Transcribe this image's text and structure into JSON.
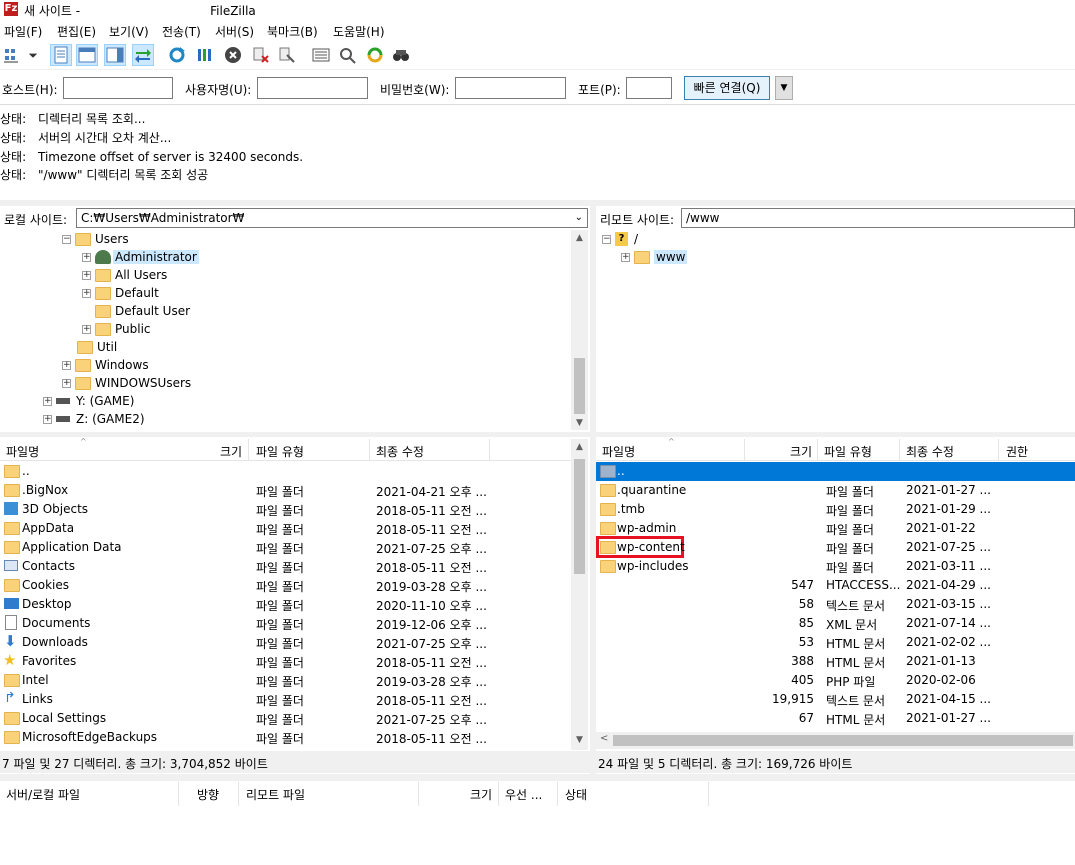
{
  "window": {
    "title_left": "새 사이트 -",
    "title_app": "FileZilla",
    "icon": "filezilla-icon"
  },
  "menu": [
    "파일(F)",
    "편집(E)",
    "보기(V)",
    "전송(T)",
    "서버(S)",
    "북마크(B)",
    "도움말(H)"
  ],
  "quickconnect": {
    "host_label": "호스트(H):",
    "user_label": "사용자명(U):",
    "pass_label": "비밀번호(W):",
    "port_label": "포트(P):",
    "host_value": "",
    "user_value": "",
    "pass_value": "",
    "port_value": "",
    "connect_label": "빠른 연결(Q)"
  },
  "log": [
    {
      "label": "상태:",
      "text": "디렉터리 목록 조회..."
    },
    {
      "label": "상태:",
      "text": "서버의 시간대 오차 계산..."
    },
    {
      "label": "상태:",
      "text": "Timezone offset of server is 32400 seconds."
    },
    {
      "label": "상태:",
      "text": "\"/www\" 디렉터리 목록 조회 성공"
    }
  ],
  "local": {
    "site_label": "로컬 사이트:",
    "path": "C:₩Users₩Administrator₩",
    "tree": [
      {
        "label": "Users",
        "exp": "−"
      },
      {
        "label": "Administrator",
        "exp": "+"
      },
      {
        "label": "All Users",
        "exp": "+"
      },
      {
        "label": "Default",
        "exp": "+"
      },
      {
        "label": "Default User",
        "exp": ""
      },
      {
        "label": "Public",
        "exp": "+"
      },
      {
        "label": "Util",
        "exp": ""
      },
      {
        "label": "Windows",
        "exp": "+"
      },
      {
        "label": "WINDOWSUsers",
        "exp": "+"
      },
      {
        "label": "Y: (GAME)",
        "exp": "+"
      },
      {
        "label": "Z: (GAME2)",
        "exp": "+"
      }
    ],
    "headers": {
      "name": "파일명",
      "size": "크기",
      "type": "파일 유형",
      "modified": "최종 수정"
    },
    "files": [
      {
        "name": "..",
        "type": "",
        "modified": ""
      },
      {
        "name": ".BigNox",
        "type": "파일 폴더",
        "modified": "2021-04-21 오후 ..."
      },
      {
        "name": "3D Objects",
        "type": "파일 폴더",
        "modified": "2018-05-11 오전 ..."
      },
      {
        "name": "AppData",
        "type": "파일 폴더",
        "modified": "2018-05-11 오전 ..."
      },
      {
        "name": "Application Data",
        "type": "파일 폴더",
        "modified": "2021-07-25 오후 ..."
      },
      {
        "name": "Contacts",
        "type": "파일 폴더",
        "modified": "2018-05-11 오전 ..."
      },
      {
        "name": "Cookies",
        "type": "파일 폴더",
        "modified": "2019-03-28 오후 ..."
      },
      {
        "name": "Desktop",
        "type": "파일 폴더",
        "modified": "2020-11-10 오후 ..."
      },
      {
        "name": "Documents",
        "type": "파일 폴더",
        "modified": "2019-12-06 오후 ..."
      },
      {
        "name": "Downloads",
        "type": "파일 폴더",
        "modified": "2021-07-25 오후 ..."
      },
      {
        "name": "Favorites",
        "type": "파일 폴더",
        "modified": "2018-05-11 오전 ..."
      },
      {
        "name": "Intel",
        "type": "파일 폴더",
        "modified": "2019-03-28 오후 ..."
      },
      {
        "name": "Links",
        "type": "파일 폴더",
        "modified": "2018-05-11 오전 ..."
      },
      {
        "name": "Local Settings",
        "type": "파일 폴더",
        "modified": "2021-07-25 오후 ..."
      },
      {
        "name": "MicrosoftEdgeBackups",
        "type": "파일 폴더",
        "modified": "2018-05-11 오전 ..."
      }
    ],
    "status": "7 파일 및 27 디렉터리. 총 크기: 3,704,852 바이트"
  },
  "remote": {
    "site_label": "리모트 사이트:",
    "path": "/www",
    "tree": [
      {
        "label": "/",
        "exp": "−"
      },
      {
        "label": "www",
        "exp": "+"
      }
    ],
    "headers": {
      "name": "파일명",
      "size": "크기",
      "type": "파일 유형",
      "modified": "최종 수정",
      "perm": "권한"
    },
    "files": [
      {
        "name": "..",
        "size": "",
        "type": "",
        "modified": ""
      },
      {
        "name": ".quarantine",
        "size": "",
        "type": "파일 폴더",
        "modified": "2021-01-27 ..."
      },
      {
        "name": ".tmb",
        "size": "",
        "type": "파일 폴더",
        "modified": "2021-01-29 ..."
      },
      {
        "name": "wp-admin",
        "size": "",
        "type": "파일 폴더",
        "modified": "2021-01-22"
      },
      {
        "name": "wp-content",
        "size": "",
        "type": "파일 폴더",
        "modified": "2021-07-25 ..."
      },
      {
        "name": "wp-includes",
        "size": "",
        "type": "파일 폴더",
        "modified": "2021-03-11 ..."
      },
      {
        "name": "",
        "size": "547",
        "type": "HTACCESS...",
        "modified": "2021-04-29 ..."
      },
      {
        "name": "",
        "size": "58",
        "type": "텍스트 문서",
        "modified": "2021-03-15 ..."
      },
      {
        "name": "",
        "size": "85",
        "type": "XML 문서",
        "modified": "2021-07-14 ..."
      },
      {
        "name": "",
        "size": "53",
        "type": "HTML 문서",
        "modified": "2021-02-02 ..."
      },
      {
        "name": "",
        "size": "388",
        "type": "HTML 문서",
        "modified": "2021-01-13"
      },
      {
        "name": "",
        "size": "405",
        "type": "PHP 파일",
        "modified": "2020-02-06"
      },
      {
        "name": "",
        "size": "19,915",
        "type": "텍스트 문서",
        "modified": "2021-04-15 ..."
      },
      {
        "name": "",
        "size": "67",
        "type": "HTML 문서",
        "modified": "2021-01-27 ..."
      }
    ],
    "status": "24 파일 및 5 디렉터리. 총 크기: 169,726 바이트"
  },
  "queue": {
    "headers": [
      "서버/로컬 파일",
      "방향",
      "리모트 파일",
      "크기",
      "우선 ...",
      "상태"
    ]
  },
  "colors": {
    "selection": "#0078d7",
    "highlight_box": "#e81123",
    "folder": "#f9d27a"
  }
}
